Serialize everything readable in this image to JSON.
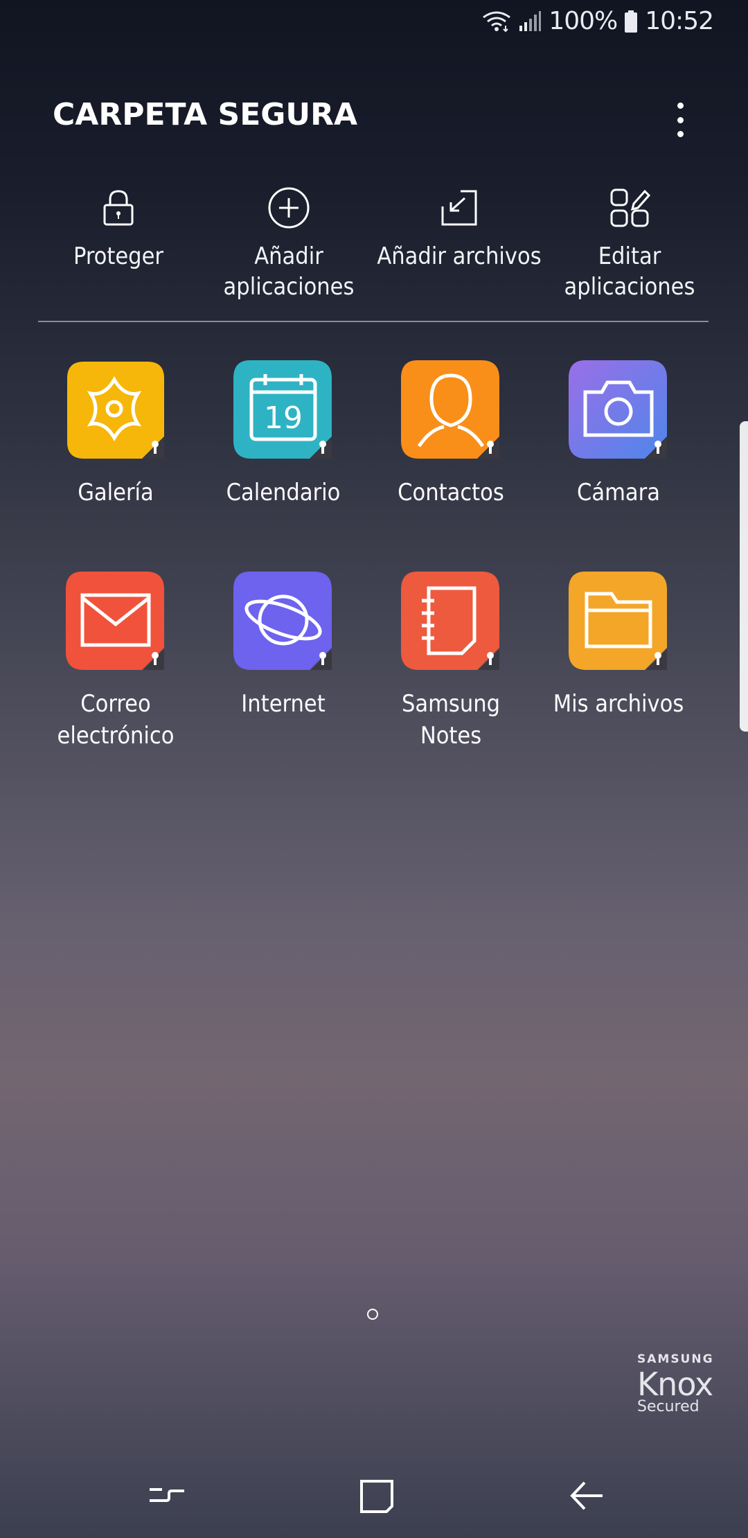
{
  "status_bar": {
    "battery": "100%",
    "time": "10:52"
  },
  "header": {
    "title": "CARPETA SEGURA"
  },
  "actions": [
    {
      "label": "Proteger",
      "icon": "lock-icon"
    },
    {
      "label": "Añadir\naplicaciones",
      "icon": "add-circle-icon"
    },
    {
      "label": "Añadir archivos",
      "icon": "add-files-icon"
    },
    {
      "label": "Editar\naplicaciones",
      "icon": "edit-apps-icon"
    }
  ],
  "apps": [
    {
      "label": "Galería",
      "icon": "gallery-icon",
      "color": "#F6B70A"
    },
    {
      "label": "Calendario",
      "icon": "calendar-icon",
      "color": "#2EB3C4",
      "day": "19"
    },
    {
      "label": "Contactos",
      "icon": "contacts-icon",
      "color": "#F98F19"
    },
    {
      "label": "Cámara",
      "icon": "camera-icon",
      "color": "#7E6FE6"
    },
    {
      "label": "Correo\nelectrónico",
      "icon": "email-icon",
      "color": "#F1523B"
    },
    {
      "label": "Internet",
      "icon": "internet-icon",
      "color": "#6D63EE"
    },
    {
      "label": "Samsung\nNotes",
      "icon": "notes-icon",
      "color": "#EE5A3E"
    },
    {
      "label": "Mis archivos",
      "icon": "my-files-icon",
      "color": "#F4A628"
    }
  ],
  "knox": {
    "brand": "SAMSUNG",
    "name": "Knox",
    "secured": "Secured"
  }
}
